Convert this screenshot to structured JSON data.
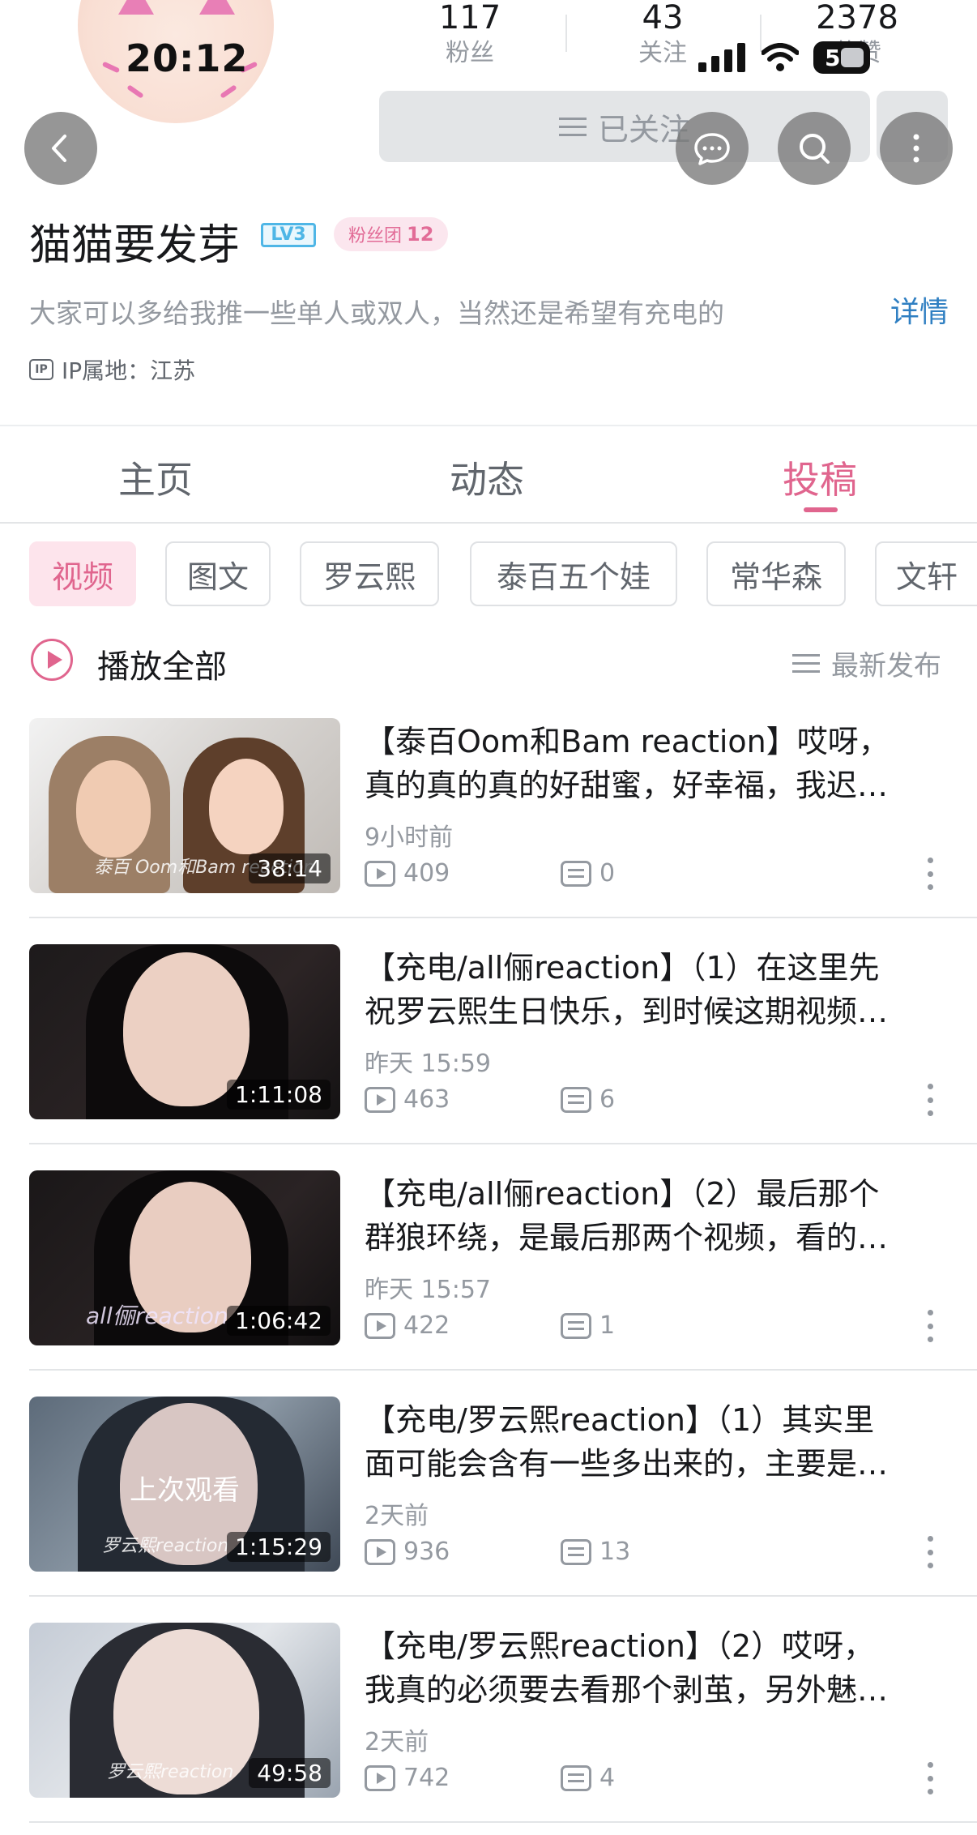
{
  "status_bar": {
    "time": "20:12",
    "battery": "5"
  },
  "profile": {
    "stats": [
      {
        "value": "117",
        "label": "粉丝"
      },
      {
        "value": "43",
        "label": "关注"
      },
      {
        "value": "2378",
        "label": "获赞"
      }
    ],
    "follow_label": "已关注",
    "name": "猫猫要发芽",
    "level": "LV3",
    "fan_badge_label": "粉丝团",
    "fan_badge_level": "12",
    "bio": "大家可以多给我推一些单人或双人，当然还是希望有充电的",
    "bio_detail": "详情",
    "ip_icon": "IP",
    "ip": "IP属地：江苏"
  },
  "tabs": [
    {
      "label": "主页",
      "active": false
    },
    {
      "label": "动态",
      "active": false
    },
    {
      "label": "投稿",
      "active": true
    }
  ],
  "chips": [
    "视频",
    "图文",
    "罗云熙",
    "泰百五个娃",
    "常华森",
    "文轩"
  ],
  "play_all_label": "播放全部",
  "sort_label": "最新发布",
  "videos": [
    {
      "title_line1": "【泰百Oom和Bam reaction】哎呀，",
      "title_line2": "真的真的真的好甜蜜，好幸福，我迟…",
      "time": "9小时前",
      "plays": "409",
      "comments": "0",
      "duration": "38:14",
      "watermark": "泰百 Oom和Bam reaction",
      "overlay": ""
    },
    {
      "title_line1": "【充电/all俪reaction】（1）在这里先",
      "title_line2": "祝罗云熙生日快乐，到时候这期视频…",
      "time": "昨天 15:59",
      "plays": "463",
      "comments": "6",
      "duration": "1:11:08",
      "watermark": "",
      "overlay": ""
    },
    {
      "title_line1": "【充电/all俪reaction】（2）最后那个",
      "title_line2": "群狼环绕，是最后那两个视频，看的…",
      "time": "昨天 15:57",
      "plays": "422",
      "comments": "1",
      "duration": "1:06:42",
      "watermark": "all俪reaction",
      "overlay": ""
    },
    {
      "title_line1": "【充电/罗云熙reaction】（1）其实里",
      "title_line2": "面可能会含有一些多出来的，主要是…",
      "time": "2天前",
      "plays": "936",
      "comments": "13",
      "duration": "1:15:29",
      "watermark": "罗云熙reaction",
      "overlay": "上次观看"
    },
    {
      "title_line1": "【充电/罗云熙reaction】（2）哎呀，",
      "title_line2": "我真的必须要去看那个剥茧，另外魅…",
      "time": "2天前",
      "plays": "742",
      "comments": "4",
      "duration": "49:58",
      "watermark": "罗云熙reaction",
      "overlay": ""
    }
  ]
}
